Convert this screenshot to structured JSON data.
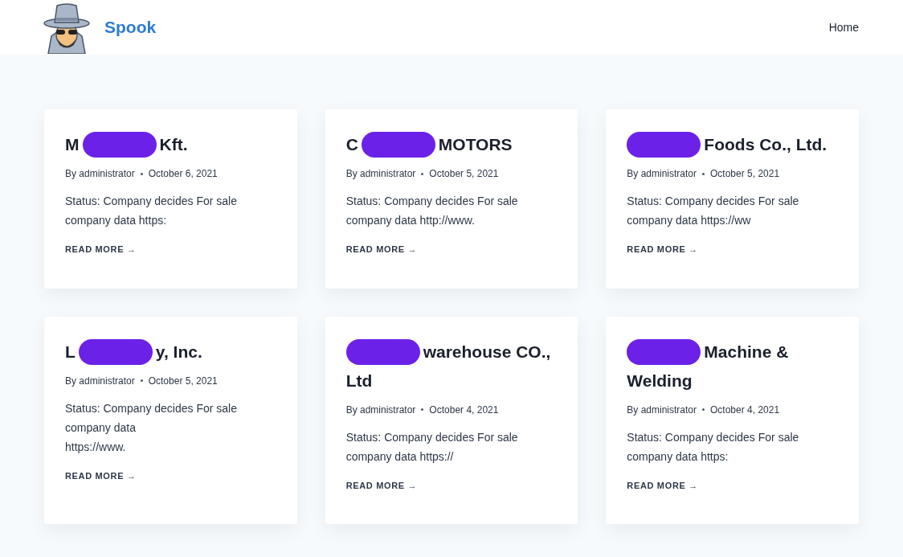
{
  "header": {
    "site_name": "Spook",
    "nav": [
      {
        "label": "Home"
      }
    ]
  },
  "posts": [
    {
      "title": [
        {
          "kind": "text",
          "text": "M"
        },
        {
          "kind": "redaction"
        },
        {
          "kind": "text",
          "text": "Kft."
        }
      ],
      "author": "By administrator",
      "date": "October 6, 2021",
      "excerpt": "Status: Company decides For sale company data https:",
      "read_more": "READ MORE →"
    },
    {
      "title": [
        {
          "kind": "text",
          "text": "C"
        },
        {
          "kind": "redaction"
        },
        {
          "kind": "text",
          "text": "MOTORS"
        }
      ],
      "author": "By administrator",
      "date": "October 5, 2021",
      "excerpt": "Status: Company decides For sale company data http://www.",
      "read_more": "READ MORE →"
    },
    {
      "title": [
        {
          "kind": "redaction"
        },
        {
          "kind": "text",
          "text": "Foods Co., Ltd."
        }
      ],
      "author": "By administrator",
      "date": "October 5, 2021",
      "excerpt": "Status: Company decides For sale company data https://ww",
      "read_more": "READ MORE →"
    },
    {
      "title": [
        {
          "kind": "text",
          "text": "L"
        },
        {
          "kind": "redaction"
        },
        {
          "kind": "text",
          "text": "y, Inc."
        }
      ],
      "author": "By administrator",
      "date": "October 5, 2021",
      "excerpt": "Status: Company decides For sale company data\nhttps://www.",
      "read_more": "READ MORE →"
    },
    {
      "title": [
        {
          "kind": "redaction"
        },
        {
          "kind": "text",
          "text": "warehouse CO.,"
        },
        {
          "kind": "text",
          "text": "Ltd"
        }
      ],
      "author": "By administrator",
      "date": "October 4, 2021",
      "excerpt": "Status: Company decides For sale company data https://",
      "read_more": "READ MORE →"
    },
    {
      "title": [
        {
          "kind": "redaction"
        },
        {
          "kind": "text",
          "text": "Machine &"
        },
        {
          "kind": "text",
          "text": "Welding"
        }
      ],
      "author": "By administrator",
      "date": "October 4, 2021",
      "excerpt": "Status: Company decides For sale company data https:",
      "read_more": "READ MORE →"
    }
  ]
}
